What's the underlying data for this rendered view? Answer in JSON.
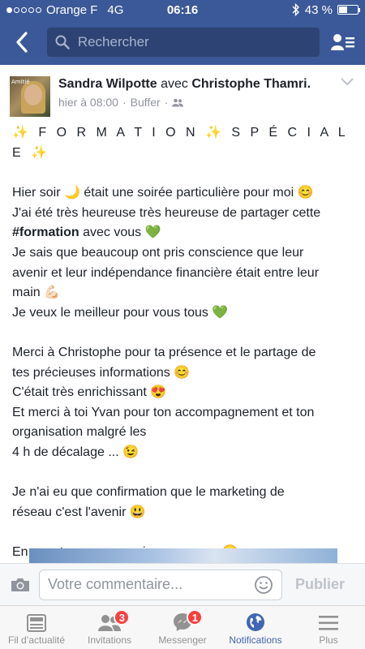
{
  "status_bar": {
    "carrier": "Orange F",
    "network": "4G",
    "time": "06:16",
    "battery": "43 %",
    "battery_level": 0.43,
    "signal_bars": 1
  },
  "nav": {
    "search_placeholder": "Rechercher"
  },
  "post": {
    "author": "Sandra Wilpotte",
    "connector": "avec",
    "tagged": "Christophe Thamri.",
    "time": "hier à 08:00",
    "separator": "·",
    "app": "Buffer",
    "separator2": "·",
    "avatar_text": "Amitié",
    "lines": [
      "Hier soir 🌙 était une soirée particulière pour moi 😊",
      "J'ai été très heureuse très heureuse de partager cette",
      "#formation avec vous 💚",
      "Je sais que beaucoup ont pris conscience que leur",
      "avenir et leur indépendance financière était entre leur",
      "main 💪🏻",
      "Je veux le meilleur pour vous tous 💚",
      "",
      "Merci à Christophe pour ta présence et le partage de",
      "tes précieuses informations 😊",
      "C'était très enrichissant 😍",
      "Et merci à toi Yvan pour ton accompagnement et ton",
      "organisation malgré les",
      "4 h de décalage ... 😉",
      "",
      "Je n'ai eu que confirmation que le marketing de",
      "réseau c'est l'avenir 😃",
      "",
      "En avant pour un avenir sur mesure 😄"
    ],
    "headline": "✨ F O R M A T I O N ✨ S P É C I A L E ✨"
  },
  "comment": {
    "placeholder": "Votre commentaire...",
    "publish_label": "Publier"
  },
  "tabs": [
    {
      "label": "Fil d’actualité",
      "badge": ""
    },
    {
      "label": "Invitations",
      "badge": "3"
    },
    {
      "label": "Messenger",
      "badge": "1"
    },
    {
      "label": "Notifications",
      "badge": ""
    },
    {
      "label": "Plus",
      "badge": ""
    }
  ],
  "colors": {
    "brand": "#3b5998",
    "active_tab": "#4267b2",
    "badge": "#fa3e3e"
  }
}
